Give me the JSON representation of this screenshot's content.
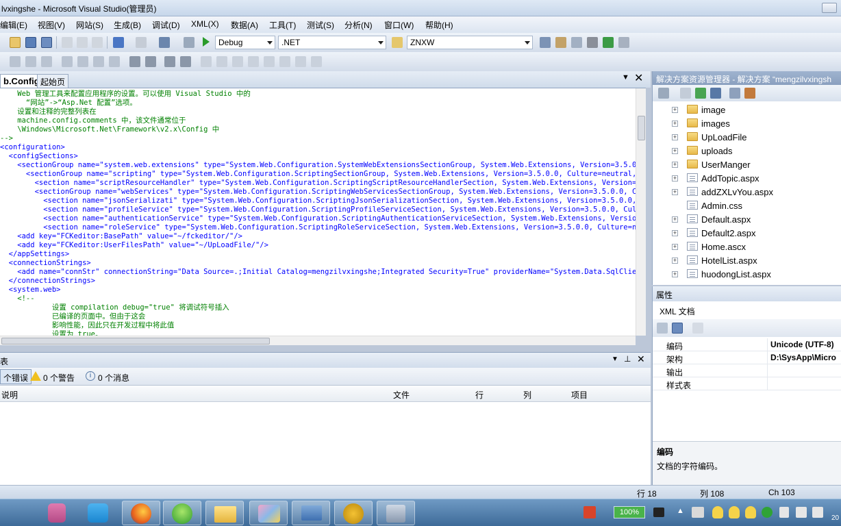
{
  "window": {
    "title": "lvxingshe - Microsoft Visual Studio(管理员)"
  },
  "menu": [
    "编辑(E)",
    "视图(V)",
    "网站(S)",
    "生成(B)",
    "调试(D)",
    "XML(X)",
    "数据(A)",
    "工具(T)",
    "测试(S)",
    "分析(N)",
    "窗口(W)",
    "帮助(H)"
  ],
  "toolbar": {
    "config": "Debug",
    "platform": ".NET",
    "find": "ZNXW"
  },
  "editor": {
    "tabs": [
      "b.Config",
      "起始页"
    ],
    "lines": [
      "    Web 管理工具来配置应用程序的设置。可以使用 Visual Studio 中的",
      "      “网站”->“Asp.Net 配置”选项。",
      "    设置和注释的完整列表在",
      "    machine.config.comments 中，该文件通常位于",
      "    \\Windows\\Microsoft.Net\\Framework\\v2.x\\Config 中",
      "-->",
      "<configuration>",
      "  <configSections>",
      "    <sectionGroup name=\"system.web.extensions\" type=\"System.Web.Configuration.SystemWebExtensionsSectionGroup, System.Web.Extensions, Version=3.5.0.0, Cultu",
      "      <sectionGroup name=\"scripting\" type=\"System.Web.Configuration.ScriptingSectionGroup, System.Web.Extensions, Version=3.5.0.0, Culture=neutral, PublicKey",
      "        <section name=\"scriptResourceHandler\" type=\"System.Web.Configuration.ScriptingScriptResourceHandlerSection, System.Web.Extensions, Version=3.5.0.0, C",
      "        <sectionGroup name=\"webServices\" type=\"System.Web.Configuration.ScriptingWebServicesSectionGroup, System.Web.Extensions, Version=3.5.0.0, Culture=neu",
      "          <section name=\"jsonSerializati\" type=\"System.Web.Configuration.ScriptingJsonSerializationSection, System.Web.Extensions, Version=3.5.0.0, Culture",
      "          <section name=\"profileService\" type=\"System.Web.Configuration.ScriptingProfileServiceSection, System.Web.Extensions, Version=3.5.0.0, Culture=neut",
      "          <section name=\"authenticationService\" type=\"System.Web.Configuration.ScriptingAuthenticationServiceSection, System.Web.Extensions, Version=3.5.0.",
      "          <section name=\"roleService\" type=\"System.Web.Configuration.ScriptingRoleServiceSection, System.Web.Extensions, Version=3.5.0.0, Culture=neutral, Pu",
      "    <add key=\"FCKeditor:BasePath\" value=\"~/fckeditor/\"/>",
      "    <add key=\"FCKeditor:UserFilesPath\" value=\"~/UpLoadFile/\"/>",
      "  </appSettings>",
      "  <connectionStrings>",
      "    <add name=\"connStr\" connectionString=\"Data Source=.;Initial Catalog=mengzilvxingshe;Integrated Security=True\" providerName=\"System.Data.SqlClient\"/>",
      "  </connectionStrings>",
      "  <system.web>",
      "    <!--",
      "            设置 compilation debug=\"true\" 将调试符号插入",
      "            已编译的页面中。但由于这会",
      "            影响性能，因此只在开发过程中将此值",
      "            设置为 true。"
    ]
  },
  "errorlist": {
    "title": "表",
    "errors": "个错误",
    "warnings": "0 个警告",
    "messages": "0 个消息",
    "columns": [
      "说明",
      "文件",
      "行",
      "列",
      "项目"
    ]
  },
  "solution": {
    "title": "解决方案资源管理器 - 解决方案 “mengzilvxingsh",
    "items": [
      {
        "name": "image",
        "kind": "folder",
        "expandable": true
      },
      {
        "name": "images",
        "kind": "folder",
        "expandable": true
      },
      {
        "name": "UpLoadFile",
        "kind": "folder",
        "expandable": true
      },
      {
        "name": "uploads",
        "kind": "folder",
        "expandable": true
      },
      {
        "name": "UserManger",
        "kind": "folder",
        "expandable": true
      },
      {
        "name": "AddTopic.aspx",
        "kind": "file",
        "expandable": true
      },
      {
        "name": "addZXLvYou.aspx",
        "kind": "file",
        "expandable": true
      },
      {
        "name": "Admin.css",
        "kind": "css",
        "expandable": false
      },
      {
        "name": "Default.aspx",
        "kind": "file",
        "expandable": true
      },
      {
        "name": "Default2.aspx",
        "kind": "file",
        "expandable": true
      },
      {
        "name": "Home.ascx",
        "kind": "file",
        "expandable": true
      },
      {
        "name": "HotelList.aspx",
        "kind": "file",
        "expandable": true
      },
      {
        "name": "huodongList.aspx",
        "kind": "file",
        "expandable": true
      }
    ]
  },
  "properties": {
    "title": "属性",
    "object": "XML 文档",
    "rows": [
      {
        "key": "编码",
        "value": "Unicode (UTF-8)"
      },
      {
        "key": "架构",
        "value": "D:\\SysApp\\Micro"
      },
      {
        "key": "输出",
        "value": ""
      },
      {
        "key": "样式表",
        "value": ""
      }
    ],
    "desc_title": "编码",
    "desc_text": "文档的字符编码。"
  },
  "status": {
    "line": "行 18",
    "col": "列 108",
    "ch": "Ch 103"
  },
  "taskbar": {
    "battery": "100%",
    "clock_partial": "20"
  },
  "colors": {
    "code_blue": "#0000ff",
    "code_maroon": "#a31515",
    "code_red": "#ff0000",
    "taskbar": "#4d7aa8"
  }
}
